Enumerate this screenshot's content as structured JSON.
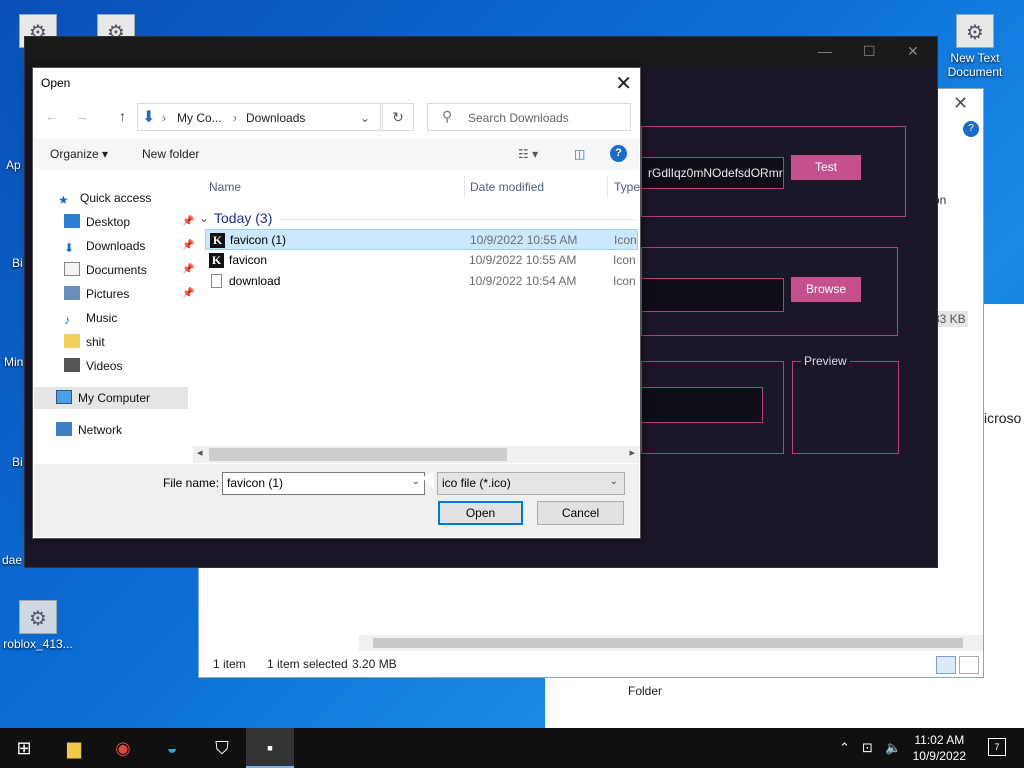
{
  "desktop": {
    "icons": [
      {
        "label": ""
      },
      {
        "label": ""
      },
      {
        "label": "New Text Document"
      },
      {
        "label": "roblox_413..."
      }
    ],
    "partial_labels": [
      "Ap",
      "Bi",
      "Min",
      "Bi",
      "dae"
    ]
  },
  "explorer_bg": {
    "footer": {
      "item_count": "1 item",
      "selected": "1 item selected",
      "size": "3.20 MB"
    },
    "size_partial": "83 KB",
    "column_partial": "on",
    "folder_text": "Folder",
    "right_text": "icroso"
  },
  "app": {
    "input_text": "rGdlIqz0mNOdefsdORmr",
    "test_button": "Test",
    "browse_button": "Browse",
    "preview_label": "Preview"
  },
  "dialog": {
    "title": "Open",
    "address": {
      "seg1": "My Co...",
      "seg2": "Downloads"
    },
    "search_placeholder": "Search Downloads",
    "toolbar": {
      "organize": "Organize",
      "new_folder": "New folder"
    },
    "nav_items": [
      {
        "label": "Quick access",
        "icon": "star-icon"
      },
      {
        "label": "Desktop",
        "icon": "desktop-folder-icon",
        "pinned": true
      },
      {
        "label": "Downloads",
        "icon": "download-folder-icon",
        "pinned": true
      },
      {
        "label": "Documents",
        "icon": "documents-folder-icon",
        "pinned": true
      },
      {
        "label": "Pictures",
        "icon": "pictures-folder-icon",
        "pinned": true
      },
      {
        "label": "Music",
        "icon": "music-icon"
      },
      {
        "label": "shit",
        "icon": "folder-icon"
      },
      {
        "label": "Videos",
        "icon": "videos-folder-icon"
      },
      {
        "label": "My Computer",
        "icon": "computer-icon"
      },
      {
        "label": "Network",
        "icon": "network-icon"
      }
    ],
    "columns": {
      "name": "Name",
      "date": "Date modified",
      "type": "Type"
    },
    "group": "Today (3)",
    "files": [
      {
        "name": "favicon (1)",
        "date": "10/9/2022 10:55 AM",
        "type": "Icon",
        "selected": true
      },
      {
        "name": "favicon",
        "date": "10/9/2022 10:55 AM",
        "type": "Icon",
        "selected": false
      },
      {
        "name": "download",
        "date": "10/9/2022 10:54 AM",
        "type": "Icon",
        "selected": false
      }
    ],
    "file_name_label": "File name:",
    "file_name_value": "favicon (1)",
    "file_type_value": "ico file (*.ico)",
    "open_button": "Open",
    "cancel_button": "Cancel"
  },
  "taskbar": {
    "time": "11:02 AM",
    "date": "10/9/2022",
    "notifications": "7"
  },
  "colors": {
    "accent": "#0078d7",
    "app_pink": "#c4508e",
    "app_bg": "#1c1629",
    "selection": "#cce8ff"
  }
}
